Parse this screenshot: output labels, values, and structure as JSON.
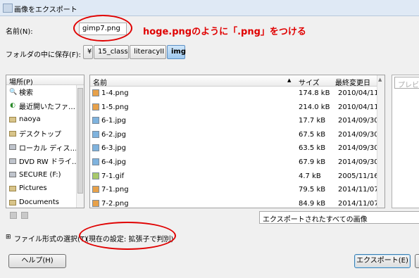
{
  "window": {
    "title": "画像をエクスポート"
  },
  "name_row": {
    "label": "名前(N):",
    "value": "gimp7.png"
  },
  "annotation": {
    "text": "hoge.pngのように「.png」をつける"
  },
  "folder_row": {
    "label": "フォルダの中に保存(F):",
    "crumbs": [
      "¥",
      "15_class",
      "literacyII",
      "img"
    ]
  },
  "places": {
    "header": "場所(P)",
    "items": [
      {
        "label": "検索",
        "icon": "search-icon"
      },
      {
        "label": "最近開いたファ…",
        "icon": "recent-icon"
      },
      {
        "label": "naoya",
        "icon": "folder-icon"
      },
      {
        "label": "デスクトップ",
        "icon": "folder-icon"
      },
      {
        "label": "ローカル ディス…",
        "icon": "drive-icon"
      },
      {
        "label": "DVD RW ドライ…",
        "icon": "drive-icon"
      },
      {
        "label": "SECURE (F:)",
        "icon": "drive-icon"
      },
      {
        "label": "Pictures",
        "icon": "folder-icon"
      },
      {
        "label": "Documents",
        "icon": "folder-icon"
      }
    ]
  },
  "files": {
    "headers": {
      "name": "名前",
      "size": "サイズ",
      "modified": "最終変更日"
    },
    "rows": [
      {
        "name": "1-4.png",
        "size": "174.8 kB",
        "date": "2010/04/11",
        "type": "png"
      },
      {
        "name": "1-5.png",
        "size": "214.0 kB",
        "date": "2010/04/11",
        "type": "png"
      },
      {
        "name": "6-1.jpg",
        "size": "17.7 kB",
        "date": "2014/09/30",
        "type": "jpg"
      },
      {
        "name": "6-2.jpg",
        "size": "67.5 kB",
        "date": "2014/09/30",
        "type": "jpg"
      },
      {
        "name": "6-3.jpg",
        "size": "63.5 kB",
        "date": "2014/09/30",
        "type": "jpg"
      },
      {
        "name": "6-4.jpg",
        "size": "67.9 kB",
        "date": "2014/09/30",
        "type": "jpg"
      },
      {
        "name": "7-1.gif",
        "size": "4.7 kB",
        "date": "2005/11/16",
        "type": "gif"
      },
      {
        "name": "7-1.png",
        "size": "79.5 kB",
        "date": "2014/11/07",
        "type": "png"
      },
      {
        "name": "7-2.png",
        "size": "84.9 kB",
        "date": "2014/11/07",
        "type": "png"
      }
    ]
  },
  "preview": {
    "label": "プレビュー"
  },
  "filter": {
    "value": "エクスポートされたすべての画像"
  },
  "filetype": {
    "label": "ファイル形式の選択(T)",
    "current": "(現在の設定: 拡張子で判別)"
  },
  "buttons": {
    "help": "ヘルプ(H)",
    "export": "エクスポート(E)"
  },
  "colors": {
    "annotation_red": "#e00000",
    "active_crumb": "#9fc9ef"
  }
}
